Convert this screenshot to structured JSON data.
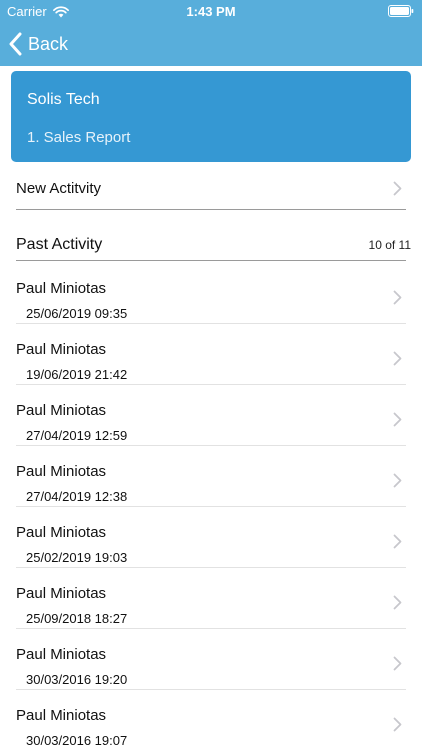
{
  "status_bar": {
    "carrier": "Carrier",
    "time": "1:43 PM"
  },
  "nav": {
    "back_label": "Back"
  },
  "company_card": {
    "company_name": "Solis Tech",
    "report_name": "1. Sales Report"
  },
  "new_activity": {
    "label": "New Actitvity"
  },
  "past_activity": {
    "title": "Past Activity",
    "count": "10 of 11",
    "items": [
      {
        "name": "Paul Miniotas",
        "date": "25/06/2019 09:35"
      },
      {
        "name": "Paul Miniotas",
        "date": "19/06/2019 21:42"
      },
      {
        "name": "Paul Miniotas",
        "date": "27/04/2019 12:59"
      },
      {
        "name": "Paul Miniotas",
        "date": "27/04/2019 12:38"
      },
      {
        "name": "Paul Miniotas",
        "date": "25/02/2019 19:03"
      },
      {
        "name": "Paul Miniotas",
        "date": "25/09/2018 18:27"
      },
      {
        "name": "Paul Miniotas",
        "date": "30/03/2016 19:20"
      },
      {
        "name": "Paul Miniotas",
        "date": "30/03/2016 19:07"
      }
    ]
  },
  "colors": {
    "header": "#58aedb",
    "card": "#3598d3",
    "chevron": "#c7c7cc"
  },
  "icons": {
    "wifi": "wifi-icon",
    "battery": "battery-icon",
    "back": "chevron-left-icon",
    "disclosure": "chevron-right-icon"
  }
}
